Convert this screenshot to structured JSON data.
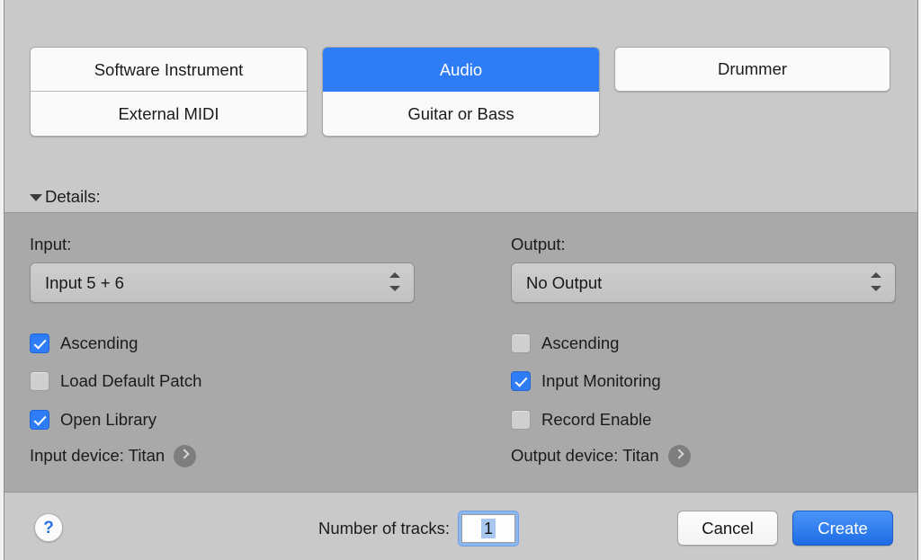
{
  "dialog": {
    "track_types": {
      "columns": [
        {
          "name": "column-instrument-midi",
          "cells": [
            {
              "label": "Software Instrument",
              "selected": false
            },
            {
              "label": "External MIDI",
              "selected": false
            }
          ]
        },
        {
          "name": "column-audio-guitar",
          "cells": [
            {
              "label": "Audio",
              "selected": true
            },
            {
              "label": "Guitar or Bass",
              "selected": false
            }
          ]
        },
        {
          "name": "column-drummer",
          "cells": [
            {
              "label": "Drummer",
              "selected": false
            }
          ]
        }
      ]
    },
    "details": {
      "disclosure_label": "Details:",
      "expanded": true,
      "input": {
        "label": "Input:",
        "value": "Input 5 + 6",
        "checkboxes": [
          {
            "label": "Ascending",
            "checked": true
          },
          {
            "label": "Load Default Patch",
            "checked": false
          },
          {
            "label": "Open Library",
            "checked": true
          }
        ],
        "device_text": "Input device: Titan"
      },
      "output": {
        "label": "Output:",
        "value": "No Output",
        "checkboxes": [
          {
            "label": "Ascending",
            "checked": false
          },
          {
            "label": "Input Monitoring",
            "checked": true
          },
          {
            "label": "Record Enable",
            "checked": false
          }
        ],
        "device_text": "Output device: Titan"
      }
    },
    "footer": {
      "help_glyph": "?",
      "tracks_label": "Number of tracks:",
      "tracks_value": "1",
      "cancel_label": "Cancel",
      "create_label": "Create"
    },
    "colors": {
      "accent_blue": "#2f7df6",
      "default_button_blue": "#1d6ce6",
      "dialog_gray": "#c9c9c9",
      "details_panel_gray": "#a9a9a9",
      "help_glyph_blue": "#2b72e0"
    }
  }
}
